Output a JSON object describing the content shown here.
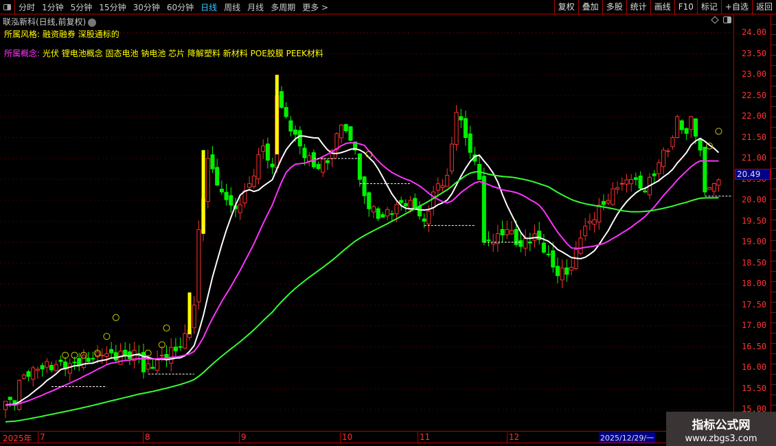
{
  "toolbar": {
    "periods": [
      "分时",
      "1分钟",
      "5分钟",
      "15分钟",
      "30分钟",
      "60分钟",
      "日线",
      "周线",
      "月线",
      "多周期",
      "更多 >"
    ],
    "active": "日线",
    "buttons": [
      "复权",
      "叠加",
      "多股",
      "统计",
      "画线",
      "F10",
      "标记",
      "+自选",
      "返回"
    ]
  },
  "title": "联泓新科(日线,前复权)",
  "style": {
    "label": "所属风格:",
    "value": "融资融券 深股通标的"
  },
  "concept": {
    "label": "所属概念:",
    "value": "光伏 锂电池概念 固态电池 钠电池 芯片 降解塑料 新材料 POE胶膜 PEEK材料"
  },
  "price_axis": [
    "24.00",
    "23.50",
    "23.00",
    "22.50",
    "22.00",
    "21.50",
    "21.00",
    "20.50",
    "20.00",
    "19.50",
    "19.00",
    "18.50",
    "18.00",
    "17.50",
    "17.00",
    "16.50",
    "16.00",
    "15.50",
    "15.00"
  ],
  "current_price": "20.49",
  "date_axis": {
    "year": "2025年",
    "months": [
      "7",
      "8",
      "9",
      "10",
      "11",
      "12"
    ],
    "selected": "2025/12/29/一"
  },
  "watermark": {
    "name": "指标公式网",
    "url": "www.zbgs3.com"
  },
  "colors": {
    "up": "#ff3232",
    "down": "#00ff00",
    "ma_short": "#ffffff",
    "ma_mid": "#ff33ff",
    "ma_long": "#33ff33",
    "accent": "#33ccff"
  },
  "chart_data": {
    "type": "candlestick",
    "ylim": [
      15.0,
      24.0
    ],
    "current": 20.49,
    "close_anchors": [
      [
        0,
        15.2
      ],
      [
        2,
        15.1
      ],
      [
        3,
        15.7
      ],
      [
        6,
        16.0
      ],
      [
        14,
        16.1
      ],
      [
        21,
        16.3
      ],
      [
        29,
        16.3
      ],
      [
        30,
        15.9
      ],
      [
        33,
        16.2
      ],
      [
        38,
        16.5
      ],
      [
        40,
        16.9
      ],
      [
        41,
        17.5
      ],
      [
        42,
        19.3
      ],
      [
        44,
        21.0
      ],
      [
        47,
        20.2
      ],
      [
        50,
        19.8
      ],
      [
        53,
        20.4
      ],
      [
        56,
        21.3
      ],
      [
        58,
        20.8
      ],
      [
        59,
        22.5
      ],
      [
        61,
        22.0
      ],
      [
        64,
        21.3
      ],
      [
        67,
        20.8
      ],
      [
        70,
        20.9
      ],
      [
        73,
        21.8
      ],
      [
        76,
        21.2
      ],
      [
        77,
        20.5
      ],
      [
        79,
        19.8
      ],
      [
        82,
        19.6
      ],
      [
        85,
        19.9
      ],
      [
        88,
        20.0
      ],
      [
        91,
        19.5
      ],
      [
        93,
        20.2
      ],
      [
        96,
        20.6
      ],
      [
        98,
        22.1
      ],
      [
        100,
        21.5
      ],
      [
        103,
        20.5
      ],
      [
        104,
        19.0
      ],
      [
        106,
        19.0
      ],
      [
        109,
        19.3
      ],
      [
        112,
        18.9
      ],
      [
        115,
        19.2
      ],
      [
        118,
        18.7
      ],
      [
        120,
        18.2
      ],
      [
        123,
        18.4
      ],
      [
        125,
        19.1
      ],
      [
        127,
        19.5
      ],
      [
        130,
        19.9
      ],
      [
        133,
        20.3
      ],
      [
        136,
        20.5
      ],
      [
        139,
        20.2
      ],
      [
        142,
        20.9
      ],
      [
        145,
        21.5
      ],
      [
        146,
        22.0
      ],
      [
        148,
        21.6
      ],
      [
        149,
        22.0
      ],
      [
        151,
        21.2
      ],
      [
        152,
        20.2
      ],
      [
        154,
        20.4
      ],
      [
        155,
        20.49
      ]
    ],
    "ma_periods": [
      10,
      20,
      60
    ],
    "markers": [
      {
        "i": 13,
        "p": 16.3,
        "t": "①"
      },
      {
        "i": 15,
        "p": 16.3,
        "t": "②"
      },
      {
        "i": 17,
        "p": 16.3,
        "t": "③"
      },
      {
        "i": 20,
        "p": 16.35,
        "t": "⑤"
      },
      {
        "i": 22,
        "p": 16.75,
        "t": "⑤"
      },
      {
        "i": 24,
        "p": 17.2,
        "t": "④"
      },
      {
        "i": 31,
        "p": 16.35,
        "t": "①"
      },
      {
        "i": 34,
        "p": 16.55,
        "t": "③"
      },
      {
        "i": 35,
        "p": 16.95,
        "t": "⑤"
      },
      {
        "i": 79,
        "p": 21.1,
        "t": "①"
      },
      {
        "i": 153,
        "p": 21.3,
        "t": "①"
      },
      {
        "i": 155,
        "p": 21.65,
        "t": "②"
      }
    ]
  }
}
